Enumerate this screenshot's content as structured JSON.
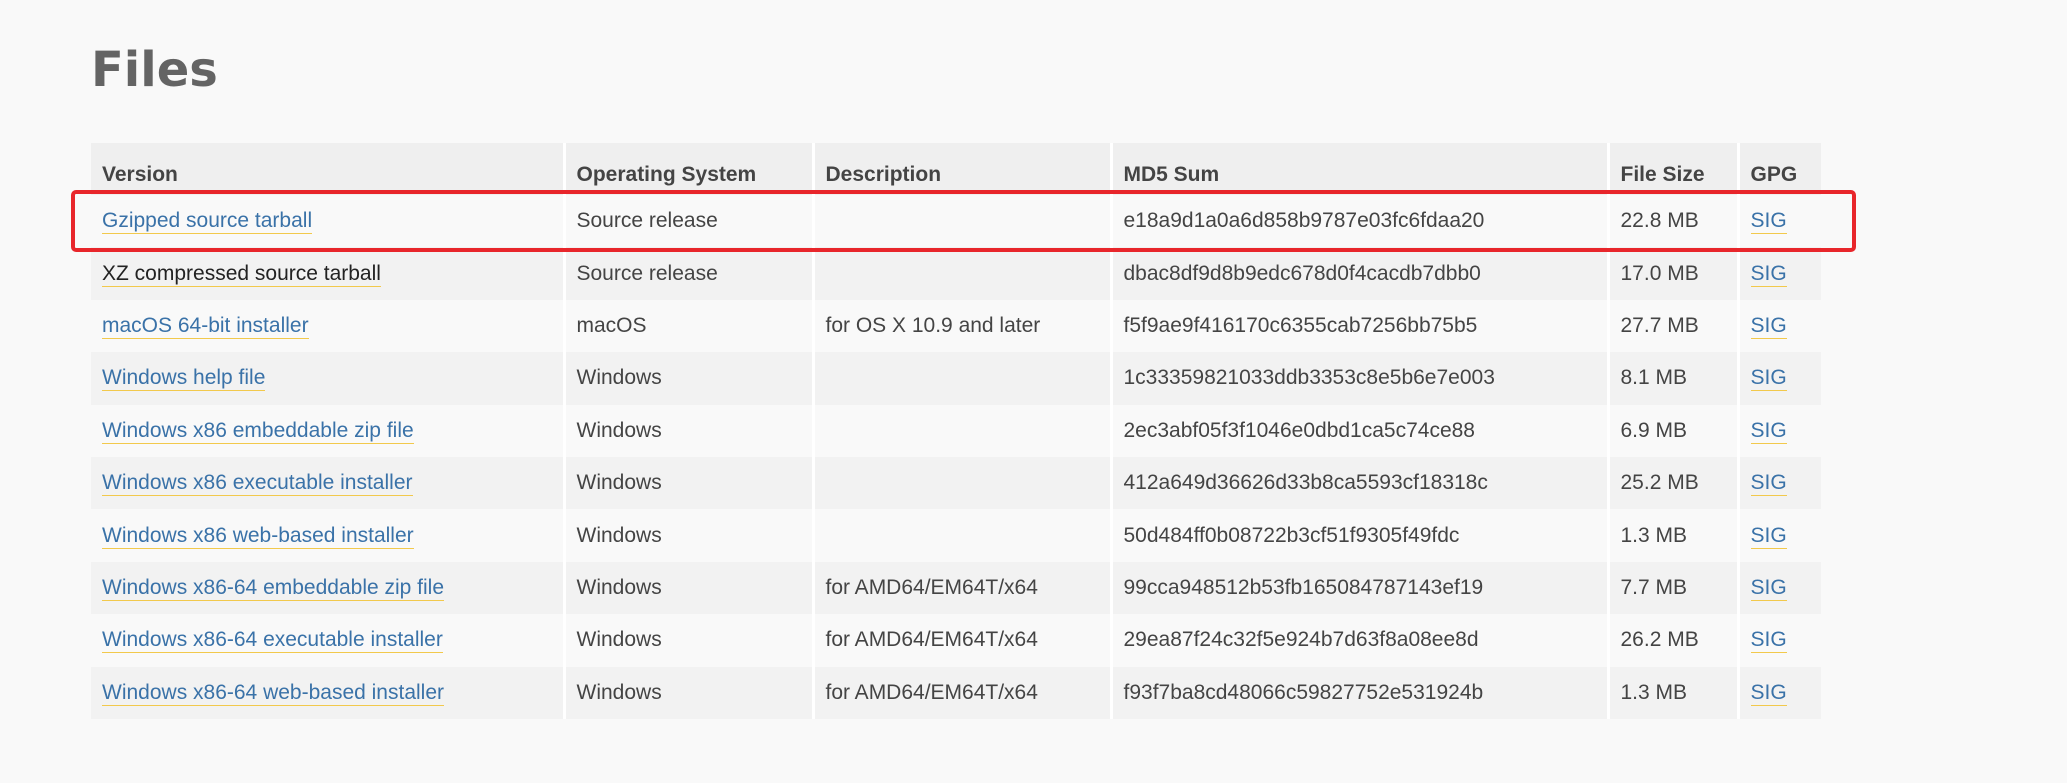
{
  "page": {
    "title": "Files"
  },
  "table": {
    "headers": [
      "Version",
      "Operating System",
      "Description",
      "MD5 Sum",
      "File Size",
      "GPG"
    ],
    "rows": [
      {
        "version": "Gzipped source tarball",
        "os": "Source release",
        "description": "",
        "md5": "e18a9d1a0a6d858b9787e03fc6fdaa20",
        "size": "22.8 MB",
        "gpg": "SIG"
      },
      {
        "version": "XZ compressed source tarball",
        "os": "Source release",
        "description": "",
        "md5": "dbac8df9d8b9edc678d0f4cacdb7dbb0",
        "size": "17.0 MB",
        "gpg": "SIG"
      },
      {
        "version": "macOS 64-bit installer",
        "os": "macOS",
        "description": "for OS X 10.9 and later",
        "md5": "f5f9ae9f416170c6355cab7256bb75b5",
        "size": "27.7 MB",
        "gpg": "SIG"
      },
      {
        "version": "Windows help file",
        "os": "Windows",
        "description": "",
        "md5": "1c33359821033ddb3353c8e5b6e7e003",
        "size": "8.1 MB",
        "gpg": "SIG"
      },
      {
        "version": "Windows x86 embeddable zip file",
        "os": "Windows",
        "description": "",
        "md5": "2ec3abf05f3f1046e0dbd1ca5c74ce88",
        "size": "6.9 MB",
        "gpg": "SIG"
      },
      {
        "version": "Windows x86 executable installer",
        "os": "Windows",
        "description": "",
        "md5": "412a649d36626d33b8ca5593cf18318c",
        "size": "25.2 MB",
        "gpg": "SIG"
      },
      {
        "version": "Windows x86 web-based installer",
        "os": "Windows",
        "description": "",
        "md5": "50d484ff0b08722b3cf51f9305f49fdc",
        "size": "1.3 MB",
        "gpg": "SIG"
      },
      {
        "version": "Windows x86-64 embeddable zip file",
        "os": "Windows",
        "description": "for AMD64/EM64T/x64",
        "md5": "99cca948512b53fb165084787143ef19",
        "size": "7.7 MB",
        "gpg": "SIG"
      },
      {
        "version": "Windows x86-64 executable installer",
        "os": "Windows",
        "description": "for AMD64/EM64T/x64",
        "md5": "29ea87f24c32f5e924b7d63f8a08ee8d",
        "size": "26.2 MB",
        "gpg": "SIG"
      },
      {
        "version": "Windows x86-64 web-based installer",
        "os": "Windows",
        "description": "for AMD64/EM64T/x64",
        "md5": "f93f7ba8cd48066c59827752e531924b",
        "size": "1.3 MB",
        "gpg": "SIG"
      }
    ]
  },
  "colors": {
    "link": "#3a72a8",
    "link_underline": "#f2c94c",
    "highlight_border": "#e8262b"
  }
}
